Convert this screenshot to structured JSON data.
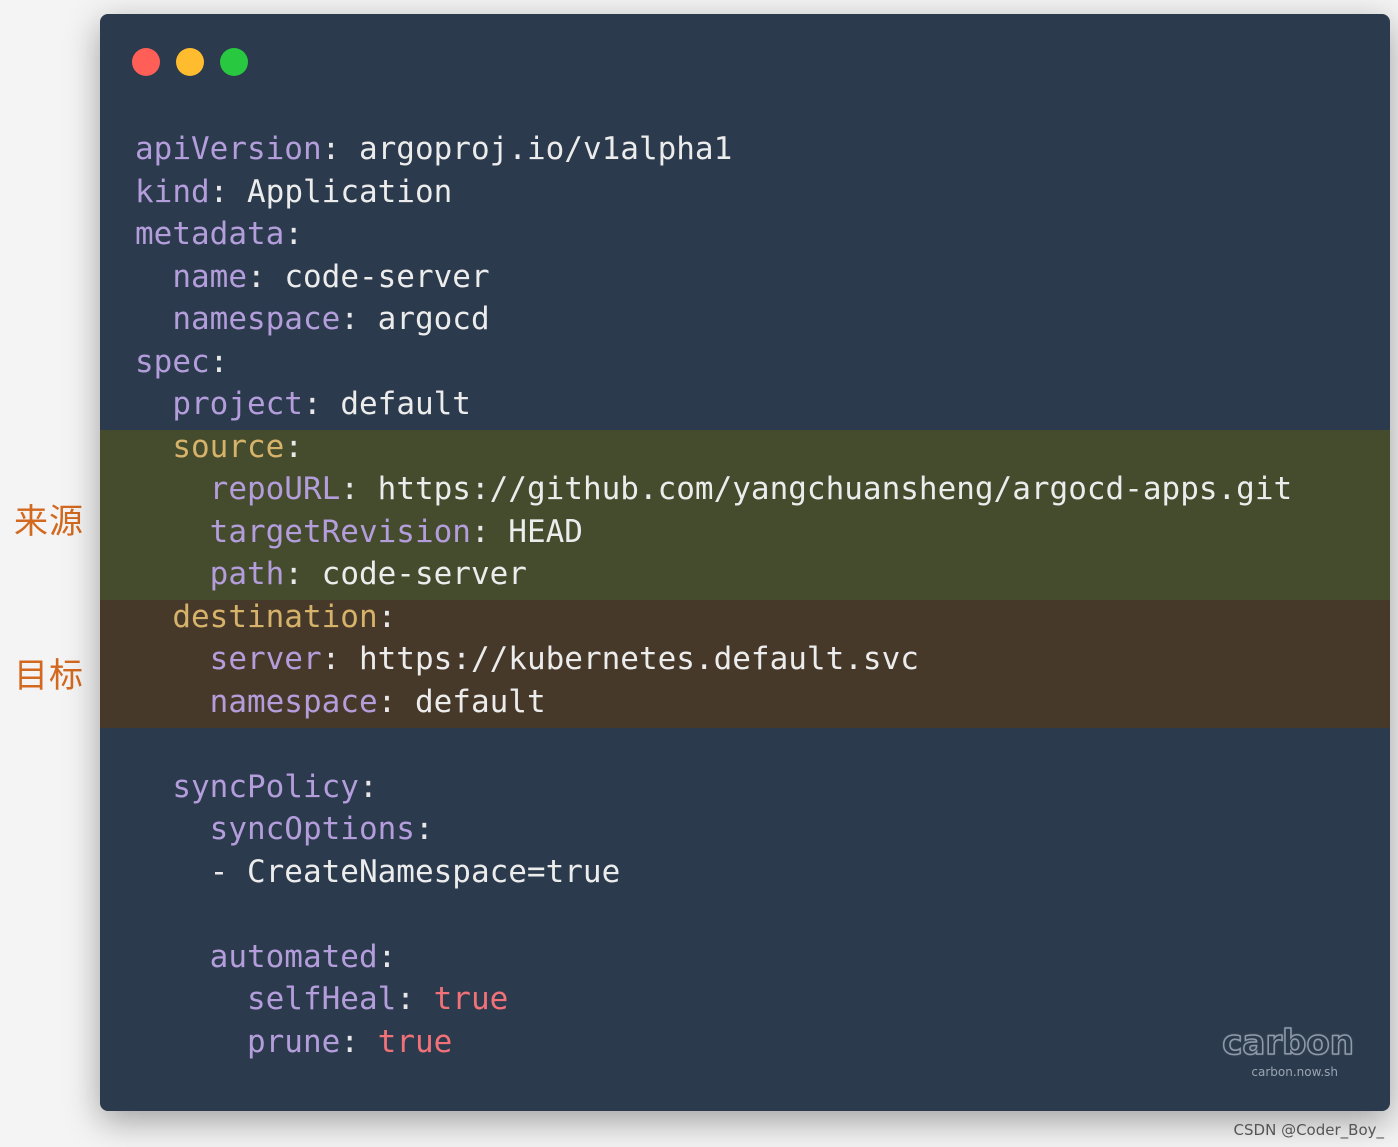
{
  "labels": {
    "source": "来源",
    "destination": "目标"
  },
  "window": {
    "buttons": [
      {
        "name": "close",
        "color": "#ff5f57"
      },
      {
        "name": "minimize",
        "color": "#febc2e"
      },
      {
        "name": "maximize",
        "color": "#28c840"
      }
    ]
  },
  "code": {
    "lines": [
      {
        "indent": "",
        "key": "apiVersion",
        "value": "argoproj.io/v1alpha1",
        "type": "str"
      },
      {
        "indent": "",
        "key": "kind",
        "value": "Application",
        "type": "str"
      },
      {
        "indent": "",
        "key": "metadata",
        "value": "",
        "type": "none"
      },
      {
        "indent": "  ",
        "key": "name",
        "value": "code-server",
        "type": "str"
      },
      {
        "indent": "  ",
        "key": "namespace",
        "value": "argocd",
        "type": "str"
      },
      {
        "indent": "",
        "key": "spec",
        "value": "",
        "type": "none"
      },
      {
        "indent": "  ",
        "key": "project",
        "value": "default",
        "type": "str"
      },
      {
        "indent": "  ",
        "key": "source",
        "value": "",
        "type": "none",
        "highlight": "source-head"
      },
      {
        "indent": "    ",
        "key": "repoURL",
        "value": "https://github.com/yangchuansheng/argocd-apps.git",
        "type": "str",
        "highlight": "source"
      },
      {
        "indent": "    ",
        "key": "targetRevision",
        "value": "HEAD",
        "type": "str",
        "highlight": "source"
      },
      {
        "indent": "    ",
        "key": "path",
        "value": "code-server",
        "type": "str",
        "highlight": "source"
      },
      {
        "indent": "  ",
        "key": "destination",
        "value": "",
        "type": "none",
        "highlight": "dest-head"
      },
      {
        "indent": "    ",
        "key": "server",
        "value": "https://kubernetes.default.svc",
        "type": "str",
        "highlight": "dest"
      },
      {
        "indent": "    ",
        "key": "namespace",
        "value": "default",
        "type": "str",
        "highlight": "dest"
      },
      {
        "indent": "",
        "key": "",
        "value": "",
        "type": "blank"
      },
      {
        "indent": "  ",
        "key": "syncPolicy",
        "value": "",
        "type": "none"
      },
      {
        "indent": "    ",
        "key": "syncOptions",
        "value": "",
        "type": "none"
      },
      {
        "indent": "    ",
        "key": "",
        "value": "- CreateNamespace=true",
        "type": "list"
      },
      {
        "indent": "",
        "key": "",
        "value": "",
        "type": "blank"
      },
      {
        "indent": "    ",
        "key": "automated",
        "value": "",
        "type": "none"
      },
      {
        "indent": "      ",
        "key": "selfHeal",
        "value": "true",
        "type": "bool"
      },
      {
        "indent": "      ",
        "key": "prune",
        "value": "true",
        "type": "bool"
      }
    ]
  },
  "branding": {
    "logo": "carbon",
    "url": "carbon.now.sh"
  },
  "watermark": "CSDN @Coder_Boy_"
}
